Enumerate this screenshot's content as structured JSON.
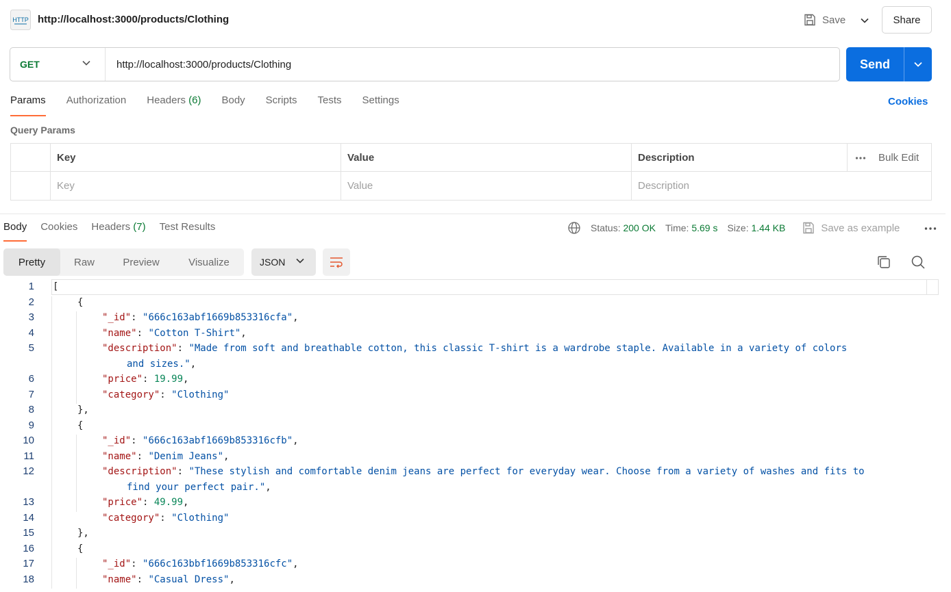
{
  "header": {
    "title": "http://localhost:3000/products/Clothing",
    "icon_text": "HTTP",
    "save_label": "Save",
    "share_label": "Share"
  },
  "request": {
    "method": "GET",
    "url": "http://localhost:3000/products/Clothing",
    "send_label": "Send"
  },
  "request_tabs": {
    "params": "Params",
    "authorization": "Authorization",
    "headers": "Headers",
    "headers_count": "(6)",
    "body": "Body",
    "scripts": "Scripts",
    "tests": "Tests",
    "settings": "Settings",
    "cookies": "Cookies"
  },
  "query_params": {
    "label": "Query Params",
    "columns": [
      "Key",
      "Value",
      "Description"
    ],
    "placeholders": [
      "Key",
      "Value",
      "Description"
    ],
    "bulk_edit": "Bulk Edit"
  },
  "response_tabs": {
    "body": "Body",
    "cookies": "Cookies",
    "headers": "Headers",
    "headers_count": "(7)",
    "test_results": "Test Results"
  },
  "status": {
    "status_label": "Status:",
    "status_value": "200 OK",
    "time_label": "Time:",
    "time_value": "5.69 s",
    "size_label": "Size:",
    "size_value": "1.44 KB",
    "save_example": "Save as example"
  },
  "view_modes": [
    "Pretty",
    "Raw",
    "Preview",
    "Visualize"
  ],
  "format": "JSON",
  "code_lines": [
    {
      "n": "1",
      "indent": 0,
      "parts": [
        [
          "p",
          "["
        ]
      ]
    },
    {
      "n": "2",
      "indent": 1,
      "parts": [
        [
          "p",
          "{"
        ]
      ]
    },
    {
      "n": "3",
      "indent": 2,
      "parts": [
        [
          "k",
          "\"_id\""
        ],
        [
          "p",
          ": "
        ],
        [
          "s",
          "\"666c163abf1669b853316cfa\""
        ],
        [
          "p",
          ","
        ]
      ]
    },
    {
      "n": "4",
      "indent": 2,
      "parts": [
        [
          "k",
          "\"name\""
        ],
        [
          "p",
          ": "
        ],
        [
          "s",
          "\"Cotton T-Shirt\""
        ],
        [
          "p",
          ","
        ]
      ]
    },
    {
      "n": "5",
      "indent": 2,
      "parts": [
        [
          "k",
          "\"description\""
        ],
        [
          "p",
          ": "
        ],
        [
          "s",
          "\"Made from soft and breathable cotton, this classic T-shirt is a wardrobe staple. Available in a variety of colors"
        ]
      ]
    },
    {
      "n": "",
      "indent": 3,
      "parts": [
        [
          "s",
          "and sizes.\""
        ],
        [
          "p",
          ","
        ]
      ]
    },
    {
      "n": "6",
      "indent": 2,
      "parts": [
        [
          "k",
          "\"price\""
        ],
        [
          "p",
          ": "
        ],
        [
          "n",
          "19.99"
        ],
        [
          "p",
          ","
        ]
      ]
    },
    {
      "n": "7",
      "indent": 2,
      "parts": [
        [
          "k",
          "\"category\""
        ],
        [
          "p",
          ": "
        ],
        [
          "s",
          "\"Clothing\""
        ]
      ]
    },
    {
      "n": "8",
      "indent": 1,
      "parts": [
        [
          "p",
          "},"
        ]
      ]
    },
    {
      "n": "9",
      "indent": 1,
      "parts": [
        [
          "p",
          "{"
        ]
      ]
    },
    {
      "n": "10",
      "indent": 2,
      "parts": [
        [
          "k",
          "\"_id\""
        ],
        [
          "p",
          ": "
        ],
        [
          "s",
          "\"666c163abf1669b853316cfb\""
        ],
        [
          "p",
          ","
        ]
      ]
    },
    {
      "n": "11",
      "indent": 2,
      "parts": [
        [
          "k",
          "\"name\""
        ],
        [
          "p",
          ": "
        ],
        [
          "s",
          "\"Denim Jeans\""
        ],
        [
          "p",
          ","
        ]
      ]
    },
    {
      "n": "12",
      "indent": 2,
      "parts": [
        [
          "k",
          "\"description\""
        ],
        [
          "p",
          ": "
        ],
        [
          "s",
          "\"These stylish and comfortable denim jeans are perfect for everyday wear. Choose from a variety of washes and fits to"
        ]
      ]
    },
    {
      "n": "",
      "indent": 3,
      "parts": [
        [
          "s",
          "find your perfect pair.\""
        ],
        [
          "p",
          ","
        ]
      ]
    },
    {
      "n": "13",
      "indent": 2,
      "parts": [
        [
          "k",
          "\"price\""
        ],
        [
          "p",
          ": "
        ],
        [
          "n",
          "49.99"
        ],
        [
          "p",
          ","
        ]
      ]
    },
    {
      "n": "14",
      "indent": 2,
      "parts": [
        [
          "k",
          "\"category\""
        ],
        [
          "p",
          ": "
        ],
        [
          "s",
          "\"Clothing\""
        ]
      ]
    },
    {
      "n": "15",
      "indent": 1,
      "parts": [
        [
          "p",
          "},"
        ]
      ]
    },
    {
      "n": "16",
      "indent": 1,
      "parts": [
        [
          "p",
          "{"
        ]
      ]
    },
    {
      "n": "17",
      "indent": 2,
      "parts": [
        [
          "k",
          "\"_id\""
        ],
        [
          "p",
          ": "
        ],
        [
          "s",
          "\"666c163bbf1669b853316cfc\""
        ],
        [
          "p",
          ","
        ]
      ]
    },
    {
      "n": "18",
      "indent": 2,
      "parts": [
        [
          "k",
          "\"name\""
        ],
        [
          "p",
          ": "
        ],
        [
          "s",
          "\"Casual Dress\""
        ],
        [
          "p",
          ","
        ]
      ]
    }
  ],
  "colors": {
    "accent": "#ff6c37",
    "send": "#0b6ee0",
    "method_get": "#0b7a34",
    "json_key": "#a31515",
    "json_string": "#0451a5",
    "json_number": "#098658"
  }
}
